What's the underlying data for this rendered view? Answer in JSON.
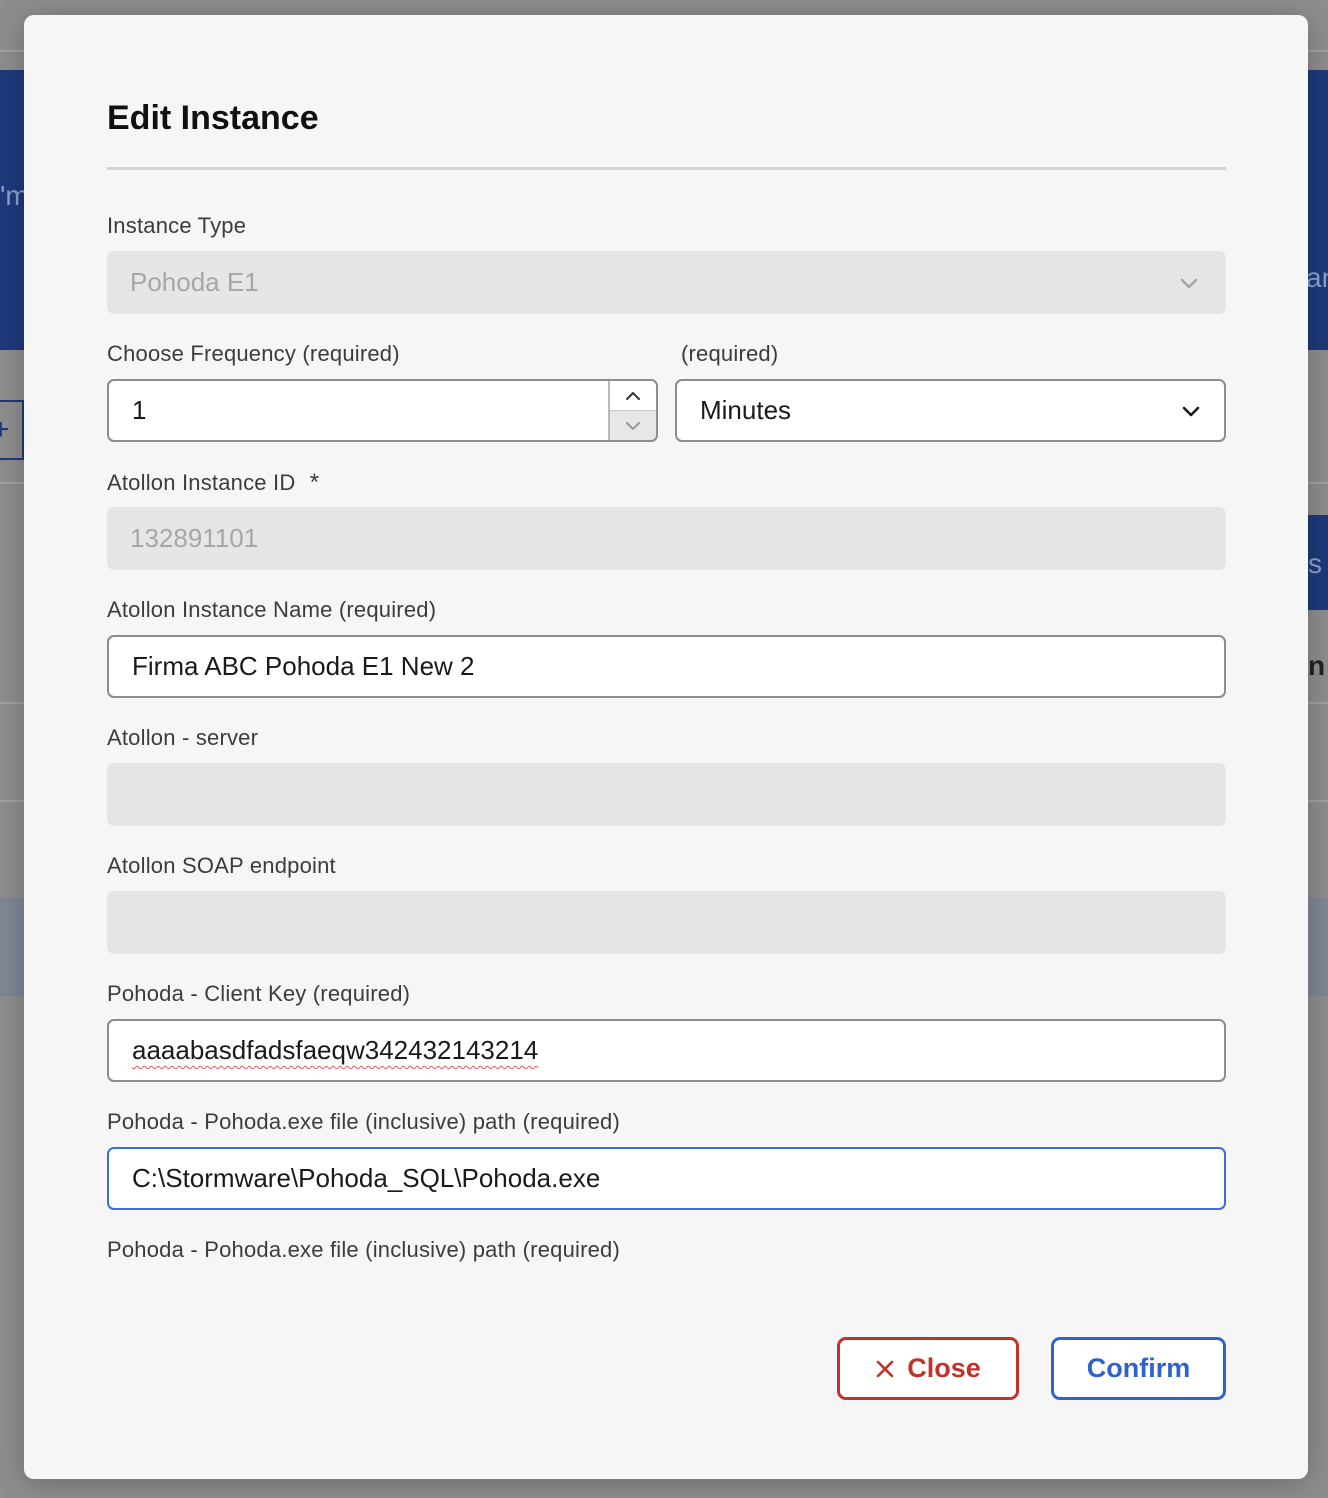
{
  "background": {
    "fragments": [
      "'m",
      "an",
      "s",
      "n"
    ]
  },
  "dialog": {
    "title": "Edit Instance",
    "instance_type": {
      "label": "Instance Type",
      "value": "Pohoda E1",
      "disabled": true
    },
    "frequency": {
      "label": "Choose Frequency (required)",
      "value": "1",
      "unit_label": "(required)",
      "unit_value": "Minutes"
    },
    "instance_id": {
      "label": "Atollon Instance ID",
      "marker": "*",
      "value": "132891101",
      "disabled": true
    },
    "instance_name": {
      "label": "Atollon Instance Name (required)",
      "value": "Firma ABC Pohoda E1 New 2"
    },
    "server": {
      "label": "Atollon - server",
      "value": ""
    },
    "soap_endpoint": {
      "label": "Atollon SOAP endpoint",
      "value": ""
    },
    "client_key": {
      "label": "Pohoda - Client Key (required)",
      "value": "aaaabasdfadsfaeqw342432143214"
    },
    "exe_path": {
      "label": "Pohoda - Pohoda.exe file (inclusive) path (required)",
      "value": "C:\\Stormware\\Pohoda_SQL\\Pohoda.exe",
      "help_text": "Pohoda - Pohoda.exe file (inclusive) path (required)"
    },
    "buttons": {
      "close_label": "Close",
      "confirm_label": "Confirm"
    }
  },
  "icons": {
    "chevron": "chevron-down-icon",
    "step_up": "chevron-up-icon",
    "step_down": "chevron-down-icon",
    "close": "close-icon"
  },
  "colors": {
    "accent_blue": "#2f63cc",
    "danger_red": "#c0332b",
    "disabled_bg": "#e6e6e6"
  }
}
